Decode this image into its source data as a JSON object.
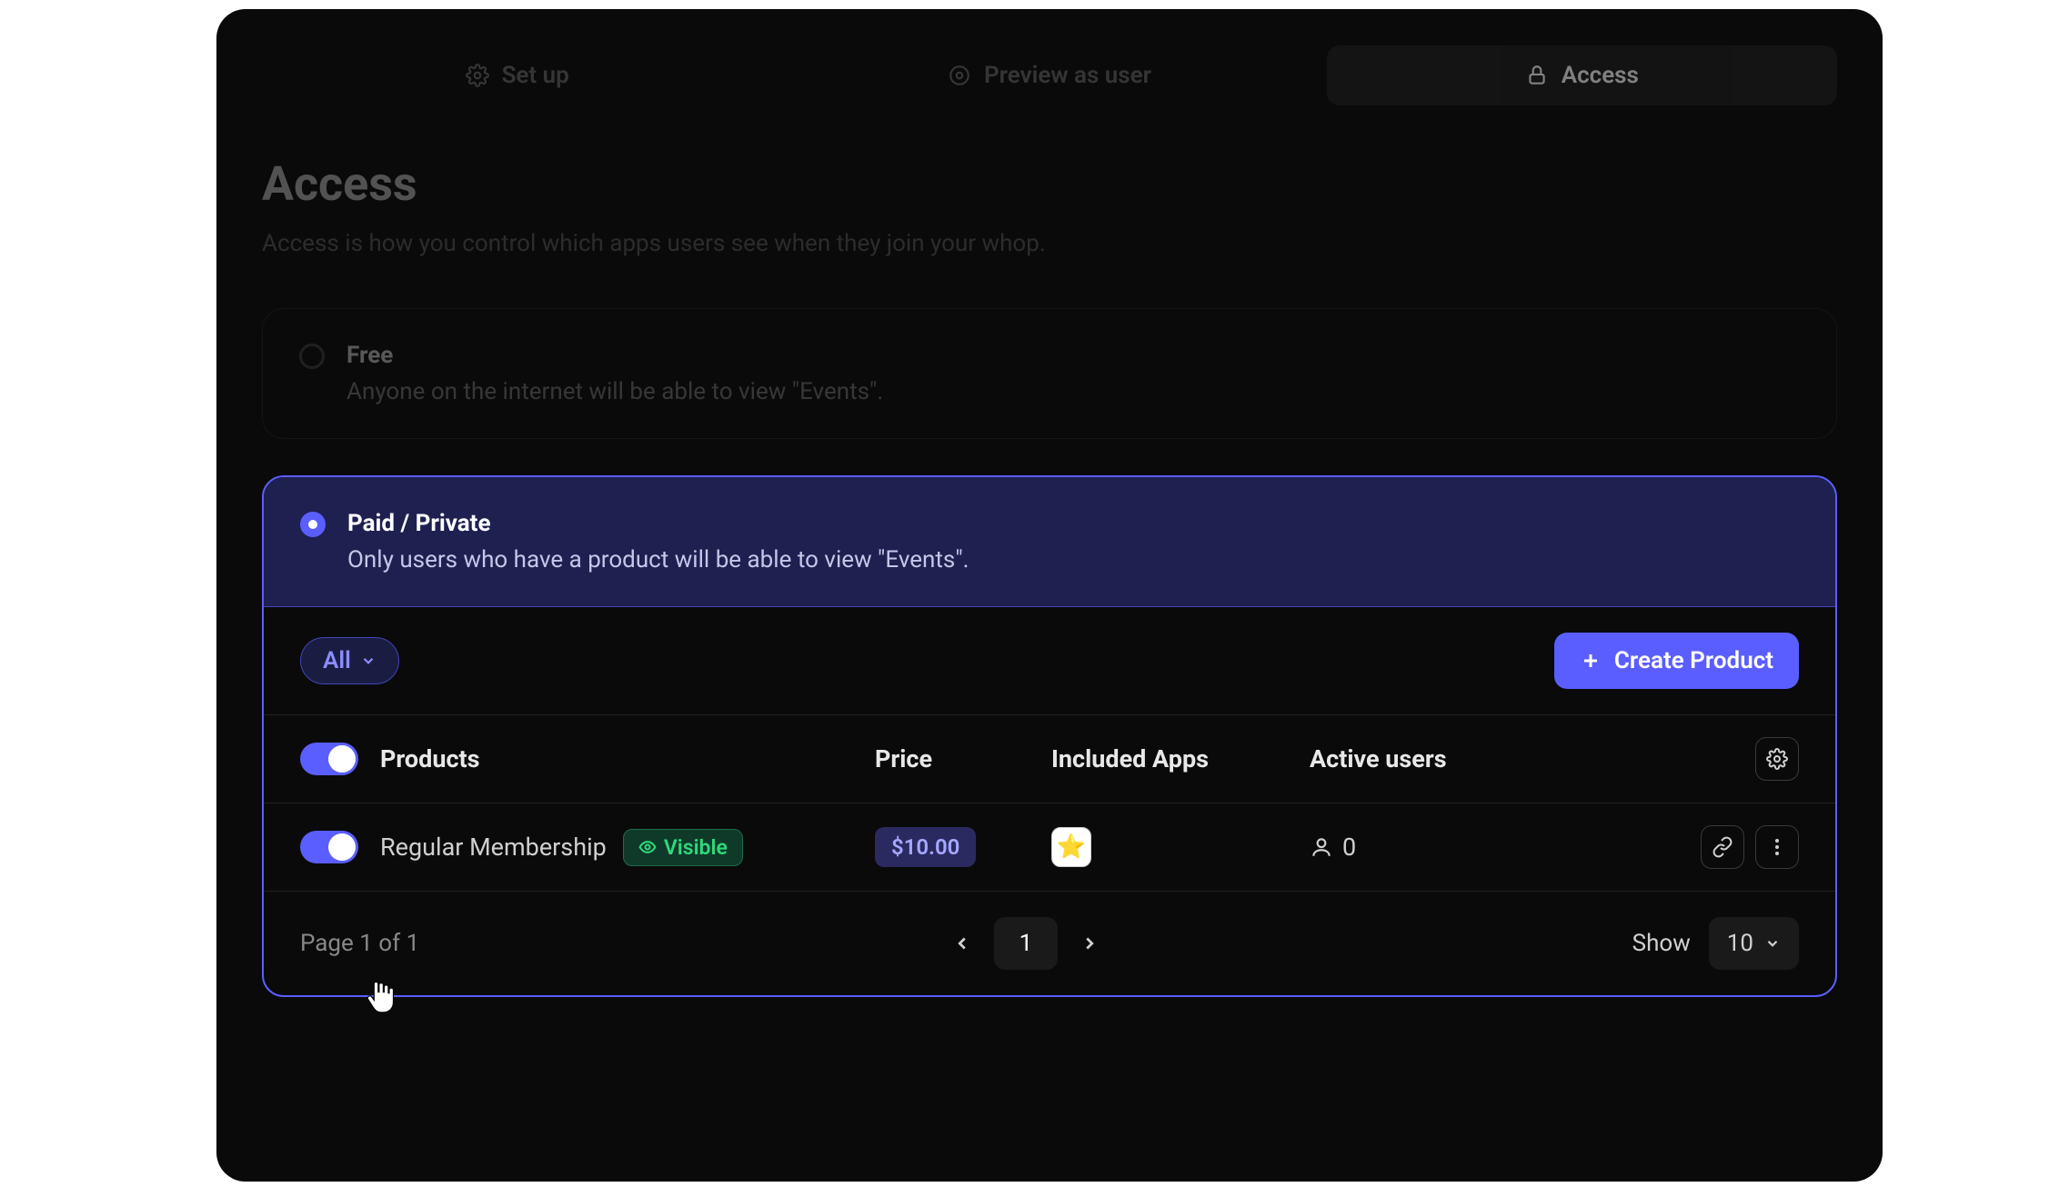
{
  "tabs": {
    "setup": "Set up",
    "preview": "Preview as user",
    "access": "Access"
  },
  "page": {
    "title": "Access",
    "subtitle": "Access is how you control which apps users see when they join your whop."
  },
  "free_card": {
    "title": "Free",
    "desc": "Anyone on the internet will be able to view \"Events\"."
  },
  "paid_card": {
    "title": "Paid / Private",
    "desc": "Only users who have a product will be able to view \"Events\"."
  },
  "filter": {
    "all_label": "All",
    "create_label": "Create Product"
  },
  "table": {
    "headers": {
      "products": "Products",
      "price": "Price",
      "apps": "Included Apps",
      "users": "Active users"
    },
    "rows": [
      {
        "name": "Regular Membership",
        "visibility": "Visible",
        "price": "$10.00",
        "active_users": "0"
      }
    ]
  },
  "pager": {
    "summary": "Page 1 of 1",
    "current": "1",
    "show_label": "Show",
    "page_size": "10"
  }
}
